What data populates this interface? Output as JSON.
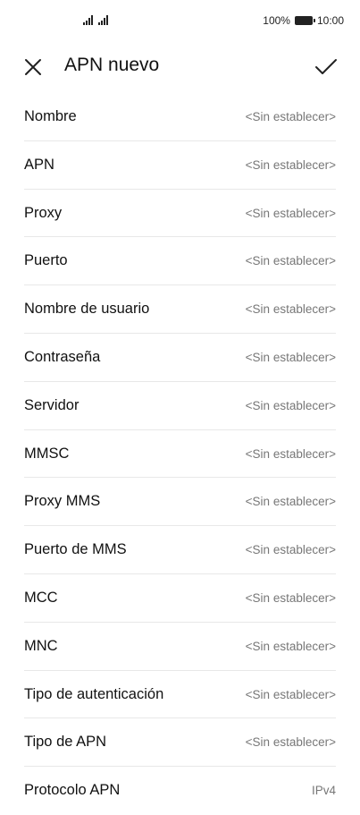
{
  "status_bar": {
    "battery_percent": "100%",
    "time": "10:00"
  },
  "header": {
    "title": "APN nuevo",
    "close_icon": "close-icon",
    "confirm_icon": "check-icon"
  },
  "settings": [
    {
      "label": "Nombre",
      "value": "<Sin establecer>"
    },
    {
      "label": "APN",
      "value": "<Sin establecer>"
    },
    {
      "label": "Proxy",
      "value": "<Sin establecer>"
    },
    {
      "label": "Puerto",
      "value": "<Sin establecer>"
    },
    {
      "label": "Nombre de usuario",
      "value": "<Sin establecer>"
    },
    {
      "label": "Contraseña",
      "value": "<Sin establecer>"
    },
    {
      "label": "Servidor",
      "value": "<Sin establecer>"
    },
    {
      "label": "MMSC",
      "value": "<Sin establecer>"
    },
    {
      "label": "Proxy MMS",
      "value": "<Sin establecer>"
    },
    {
      "label": "Puerto de MMS",
      "value": "<Sin establecer>"
    },
    {
      "label": "MCC",
      "value": "<Sin establecer>"
    },
    {
      "label": "MNC",
      "value": "<Sin establecer>"
    },
    {
      "label": "Tipo de autenticación",
      "value": "<Sin establecer>"
    },
    {
      "label": "Tipo de APN",
      "value": "<Sin establecer>"
    },
    {
      "label": "Protocolo APN",
      "value": "IPv4"
    }
  ]
}
